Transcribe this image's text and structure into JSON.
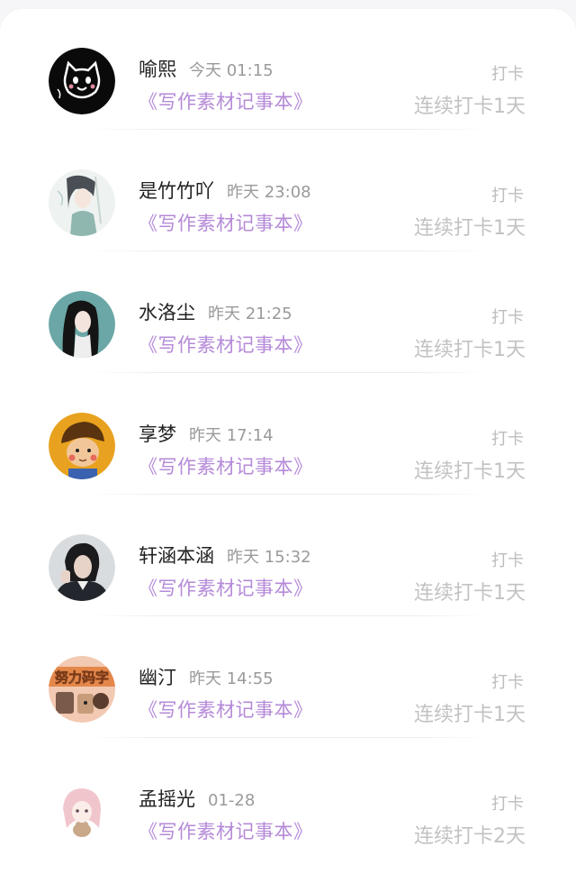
{
  "checkins": [
    {
      "name": "喻熙",
      "time": "今天 01:15",
      "group": "《写作素材记事本》",
      "type": "打卡",
      "streak": "连续打卡1天",
      "avatar_icon": "black-cat-avatar"
    },
    {
      "name": "是竹竹吖",
      "time": "昨天 23:08",
      "group": "《写作素材记事本》",
      "type": "打卡",
      "streak": "连续打卡1天",
      "avatar_icon": "illustrated-girl-avatar"
    },
    {
      "name": "水洛尘",
      "time": "昨天 21:25",
      "group": "《写作素材记事本》",
      "type": "打卡",
      "streak": "连续打卡1天",
      "avatar_icon": "dark-hair-girl-avatar"
    },
    {
      "name": "享梦",
      "time": "昨天 17:14",
      "group": "《写作素材记事本》",
      "type": "打卡",
      "streak": "连续打卡1天",
      "avatar_icon": "cartoon-boy-avatar"
    },
    {
      "name": "轩涵本涵",
      "time": "昨天 15:32",
      "group": "《写作素材记事本》",
      "type": "打卡",
      "streak": "连续打卡1天",
      "avatar_icon": "photo-girl-avatar"
    },
    {
      "name": "幽汀",
      "time": "昨天 14:55",
      "group": "《写作素材记事本》",
      "type": "打卡",
      "streak": "连续打卡1天",
      "avatar_icon": "cartoon-sticker-avatar",
      "avatar_text": "努力码字"
    },
    {
      "name": "孟摇光",
      "time": "01-28",
      "group": "《写作素材记事本》",
      "type": "打卡",
      "streak": "连续打卡2天",
      "avatar_icon": "pink-hair-girl-avatar"
    }
  ],
  "colors": {
    "group_link": "#b58ad8",
    "name": "#222222",
    "meta": "#9a9a9a",
    "streak": "#c2c2c2"
  }
}
